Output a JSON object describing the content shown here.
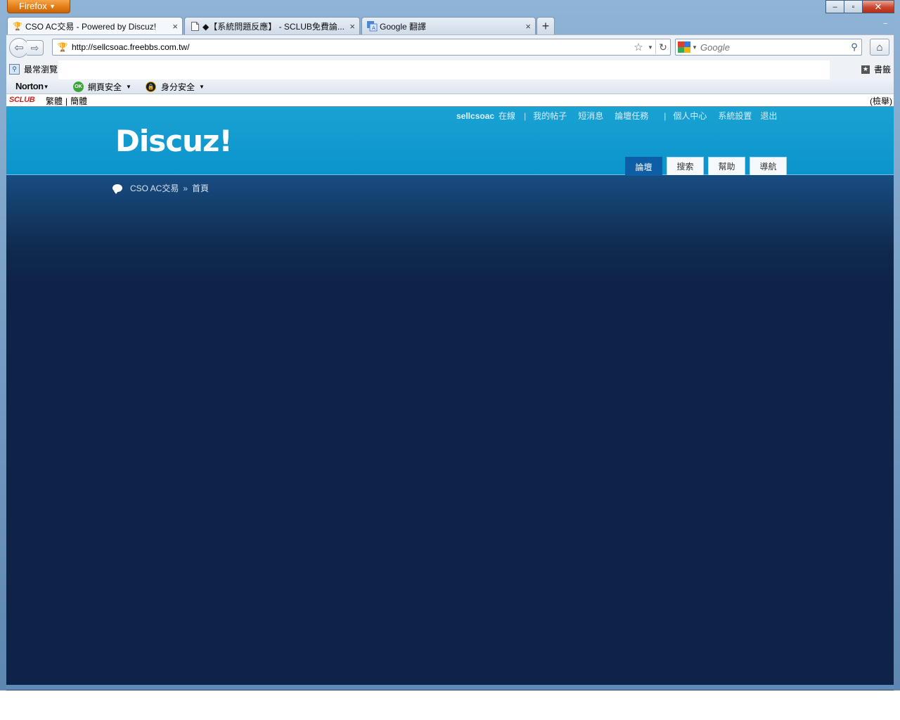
{
  "window": {
    "firefox_button_label": "Firefox",
    "controls": {
      "minimize": "‒",
      "maximize": "▫",
      "close": "✕"
    }
  },
  "tabs": [
    {
      "label": "CSO AC交易 - Powered by Discuz!",
      "icon": "trophy-icon",
      "active": true
    },
    {
      "label": "◆【系統問題反應】 - SCLUB免費論...",
      "icon": "page-icon",
      "active": false
    },
    {
      "label": "Google 翻譯",
      "icon": "translate-icon",
      "active": false
    }
  ],
  "tab_close_glyph": "×",
  "newtab_glyph": "+",
  "navbar": {
    "url": "http://sellcsoac.freebbs.com.tw/",
    "search_placeholder": "Google"
  },
  "bookmarks": {
    "most_visited": "最常瀏覽",
    "bookmarks_menu": "書籤"
  },
  "norton": {
    "logo": "Norton",
    "web_safety": "網頁安全",
    "identity_safe": "身分安全",
    "ok_badge": "OK"
  },
  "sclub": {
    "logo": "SCLUB",
    "traditional": "繁體",
    "simplified": "簡體",
    "report": "(檢舉)"
  },
  "page": {
    "user": "sellcsoac",
    "online": "在線",
    "links": [
      "我的帖子",
      "短消息",
      "論壇任務"
    ],
    "links2": [
      "個人中心",
      "系統設置",
      "退出"
    ],
    "logo": "Discuz!",
    "nav_tabs": [
      "論壇",
      "搜索",
      "幫助",
      "導航"
    ],
    "breadcrumb": {
      "forum": "CSO AC交易",
      "sep": "»",
      "current": "首頁"
    }
  }
}
